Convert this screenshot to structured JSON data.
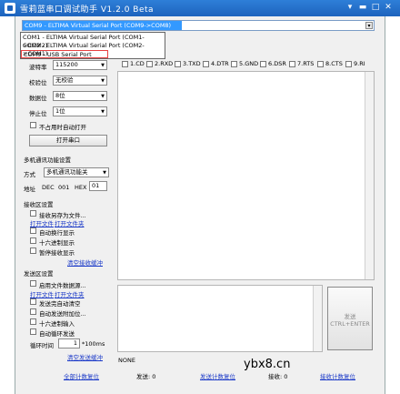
{
  "window": {
    "title": "雪莉蓝串口调试助手 V1.2.0 Beta",
    "ctrl_pin": "▾",
    "ctrl_min": "▬",
    "ctrl_max": "□",
    "ctrl_close": "✕"
  },
  "port_select": {
    "value": "COM9 - ELTIMA Virtual Serial Port (COM9->COM8)"
  },
  "port_dropdown": {
    "options": [
      "COM1 - ELTIMA Virtual Serial Port (COM1->COM2)",
      "COM2 - ELTIMA Virtual Serial Port (COM2->COM1)",
      "COM9 - USB Serial Port"
    ]
  },
  "serial_settings": {
    "baud_label": "波特率",
    "baud_value": "115200",
    "parity_label": "校验位",
    "parity_value": "无校验",
    "data_label": "数据位",
    "data_value": "8位",
    "stop_label": "停止位",
    "stop_value": "1位",
    "no_occupy_label": "不占用时自动打开",
    "open_button": "打开串口"
  },
  "signals": [
    "1.CD",
    "2.RXD",
    "3.TXD",
    "4.DTR",
    "5.GND",
    "6.DSR",
    "7.RTS",
    "8.CTS",
    "9.RI"
  ],
  "multi_comm": {
    "section": "多机通讯功能设置",
    "mode_label": "方式",
    "mode_value": "多机通讯功能关",
    "addr_label": "地址",
    "addr_dec": "DEC",
    "addr_dec_val": "001",
    "addr_hex": "HEX",
    "addr_hex_val": "01"
  },
  "receive": {
    "section": "接收区设置",
    "save_to_file": "接收另存为文件...",
    "open_file": "打开文件",
    "open_folder": "打开文件夹",
    "auto_newline": "自动换行显示",
    "hex_display": "十六进制显示",
    "pause_display": "暂停接收显示",
    "clear": "清空接收缓冲"
  },
  "send": {
    "section": "发送区设置",
    "file_data": "启用文件数据源...",
    "open_file": "打开文件",
    "open_folder": "打开文件夹",
    "auto_clear": "发送完自动清空",
    "auto_append": "自动发送附加位...",
    "hex_input": "十六进制输入",
    "auto_loop": "自动循环发送",
    "loop_label": "循环时间",
    "loop_value": "1",
    "loop_unit": "*100ms",
    "clear": "清空发送缓冲",
    "send_button": "发送\nCTRL+ENTER"
  },
  "status": {
    "none": "NONE",
    "clear_all": "全部计数复位",
    "sent_label": "发送: 0",
    "sent_reset": "发送计数复位",
    "recv_label": "接收: 0",
    "recv_reset": "接收计数复位"
  },
  "watermark": "ybx8.cn"
}
